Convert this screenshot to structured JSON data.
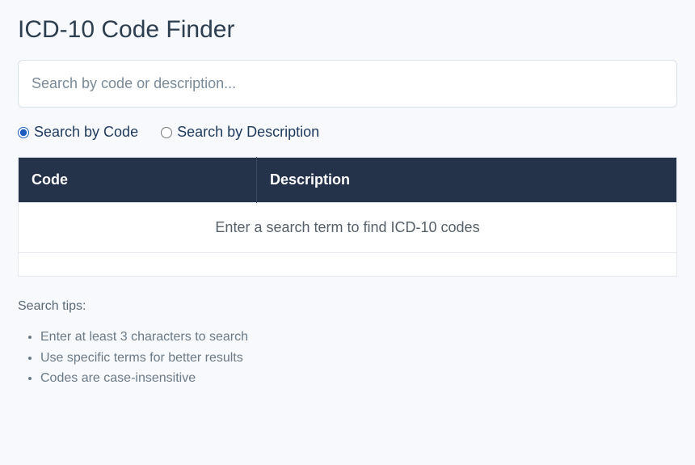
{
  "page": {
    "title": "ICD-10 Code Finder"
  },
  "search": {
    "placeholder": "Search by code or description...",
    "value": ""
  },
  "search_mode": {
    "options": [
      {
        "label": "Search by Code",
        "value": "code",
        "checked": true
      },
      {
        "label": "Search by Description",
        "value": "description",
        "checked": false
      }
    ]
  },
  "results": {
    "columns": [
      "Code",
      "Description"
    ],
    "rows": [],
    "empty_message": "Enter a search term to find ICD-10 codes"
  },
  "tips": {
    "heading": "Search tips:",
    "items": [
      "Enter at least 3 characters to search",
      "Use specific terms for better results",
      "Codes are case-insensitive"
    ]
  }
}
